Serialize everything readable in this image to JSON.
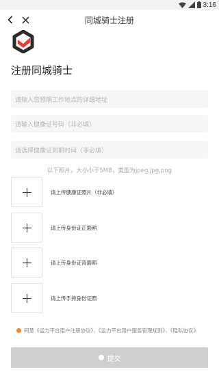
{
  "status_bar": {
    "time": "3:16"
  },
  "nav": {
    "title": "同城骑士注册"
  },
  "page_title": "注册同城骑士",
  "fields": [
    {
      "placeholder": "请输入您预期工作地点的详细地址"
    },
    {
      "placeholder": "请输入健康证号码（非必填）"
    },
    {
      "placeholder": "请选择健康证到期时间（非必填）"
    }
  ],
  "photo_note": "以下照片，大小小于5MB，类型为jpeg,jpg,png",
  "uploads": [
    {
      "label": "请上传健康证照片（非必填）"
    },
    {
      "label": "请上传身份证正面照"
    },
    {
      "label": "请上传身份证背面照"
    },
    {
      "label": "请上传手持身份证照"
    }
  ],
  "agreement": {
    "text": "同意《运力平台用户注册协议》、《运力平台用户服务管理规则》、《隐私协议》"
  },
  "submit": {
    "label": "提交"
  },
  "colors": {
    "accent": "#f0883a",
    "logo_red": "#e8393b",
    "logo_dark": "#2b2b2b",
    "button_disabled": "#cfcfcf"
  }
}
